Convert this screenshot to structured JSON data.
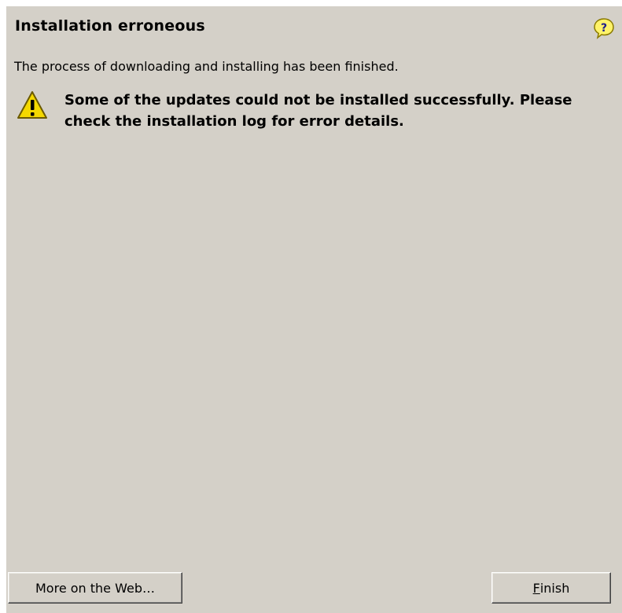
{
  "dialog": {
    "title": "Installation erroneous",
    "description": "The process of downloading and installing has been finished.",
    "warning_message": "Some of the updates could not be installed successfully. Please check the installation log for error details.",
    "icons": {
      "help": "help-question-icon",
      "warning": "warning-triangle-icon"
    }
  },
  "buttons": {
    "more_on_web": "More on the Web…",
    "finish_mnemonic": "F",
    "finish_rest": "inish"
  },
  "colors": {
    "dialog_background": "#d4d0c8",
    "warning_yellow": "#f4d800",
    "help_yellow": "#fff36a"
  }
}
